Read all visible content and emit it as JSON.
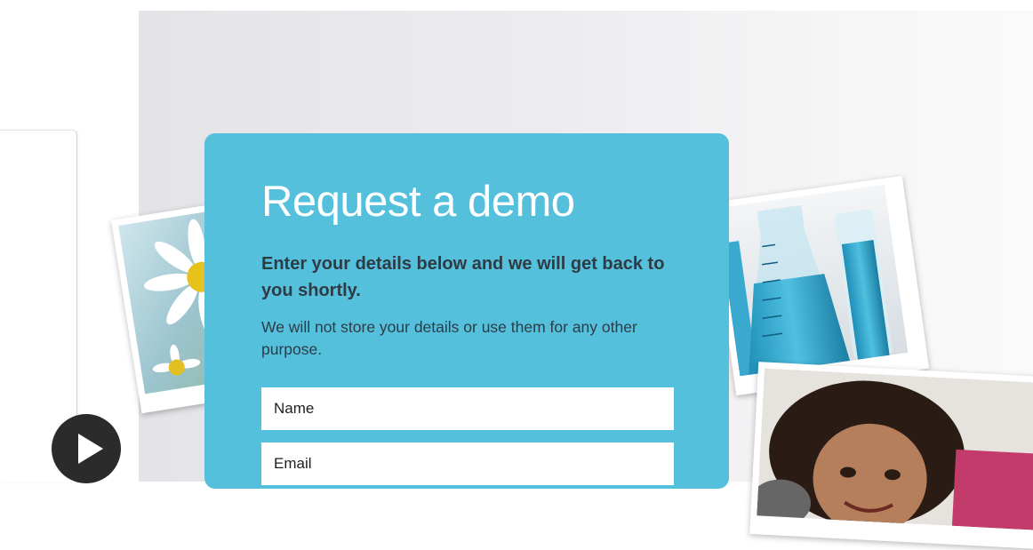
{
  "form": {
    "title": "Request a demo",
    "subtitle": "Enter your details below and we will get back to you shortly.",
    "note": "We will not store your details or use them for any other purpose.",
    "name_placeholder": "Name",
    "email_placeholder": "Email"
  },
  "media": {
    "play_icon": "play-icon",
    "photos": [
      "daisy-flower-photo",
      "lab-beaker-photo",
      "smiling-girl-photo"
    ]
  },
  "colors": {
    "card_background": "#55c0dc",
    "title_text": "#ffffff",
    "body_text": "#2f3b44",
    "play_button": "#2b2b2b"
  }
}
